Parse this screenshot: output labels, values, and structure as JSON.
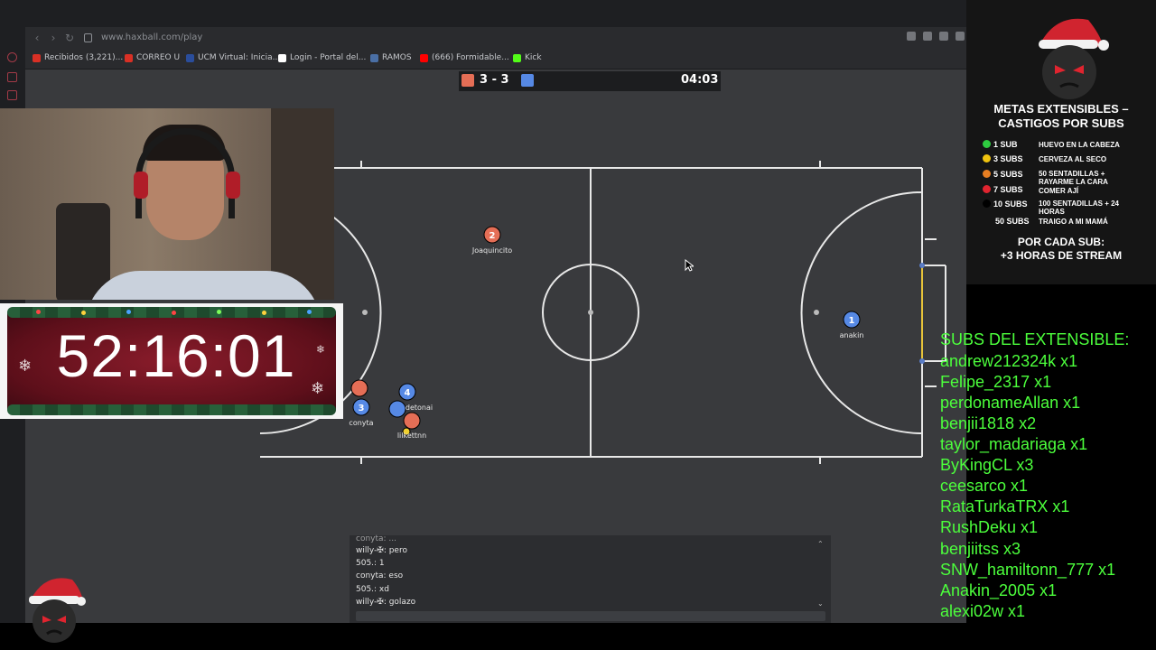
{
  "browser": {
    "url": "www.haxball.com/play",
    "bookmarks": [
      {
        "label": "Recibidos (3,221)...",
        "color": "#d93025"
      },
      {
        "label": "CORREO U",
        "color": "#d93025"
      },
      {
        "label": "UCM Virtual: Inicia...",
        "color": "#2a4d9b"
      },
      {
        "label": "Login - Portal del...",
        "color": "#ffffff"
      },
      {
        "label": "RAMOS",
        "color": "#4a6fa5"
      },
      {
        "label": "(666) Formidable...",
        "color": "#ff0000"
      },
      {
        "label": "Kick",
        "color": "#53fc18"
      }
    ]
  },
  "game": {
    "score": "3 - 3",
    "clock": "04:03",
    "red_color": "#e56e56",
    "blue_color": "#5689e5",
    "players": [
      {
        "number": "2",
        "name": "Joaquincito",
        "team": "red"
      },
      {
        "number": "1",
        "name": "anakin",
        "team": "blue"
      },
      {
        "number": "3",
        "name": "conyta",
        "team": "blue"
      },
      {
        "number": "4",
        "name": "detonai",
        "team": "blue"
      },
      {
        "number": "",
        "name": "lilkettnn",
        "team": "red"
      }
    ]
  },
  "chat": {
    "messages": [
      "conyta: ...",
      "willy-✠: pero",
      "505.: 1",
      "conyta: eso",
      "505.: xd",
      "willy-✠: golazo"
    ]
  },
  "timer": {
    "value": "52:16:01"
  },
  "goals_panel": {
    "title_line1": "METAS EXTENSIBLES –",
    "title_line2": "CASTIGOS POR SUBS",
    "rows": [
      {
        "subs": "1 SUB",
        "punishment": "HUEVO EN LA CABEZA",
        "color": "#2ecc40"
      },
      {
        "subs": "3 SUBS",
        "punishment": "CERVEZA AL SECO",
        "color": "#f1c40f"
      },
      {
        "subs": "5 SUBS",
        "punishment": "50 SENTADILLAS + RAYARME LA CARA",
        "color": "#e67e22"
      },
      {
        "subs": "7 SUBS",
        "punishment": "COMER AJÍ",
        "color": "#e0242f"
      },
      {
        "subs": "10 SUBS",
        "punishment": "100 SENTADILLAS + 24 HORAS",
        "color": "#000000"
      },
      {
        "subs": "50 SUBS",
        "punishment": "TRAIGO A MI MAMÁ",
        "color": ""
      }
    ],
    "footer_line1": "POR CADA SUB:",
    "footer_line2": "+3 HORAS DE STREAM"
  },
  "subs_list": {
    "title": "SUBS DEL EXTENSIBLE:",
    "items": [
      "andrew212324k x1",
      "Felipe_2317 x1",
      "perdonameAllan x1",
      "benjii1818 x2",
      "taylor_madariaga x1",
      "ByKingCL x3",
      "ceesarco x1",
      "RataTurkaTRX x1",
      "RushDeku x1",
      "benjiitss x3",
      "SNW_hamiltonn_777 x1",
      "Anakin_2005 x1",
      "alexi02w x1"
    ]
  }
}
